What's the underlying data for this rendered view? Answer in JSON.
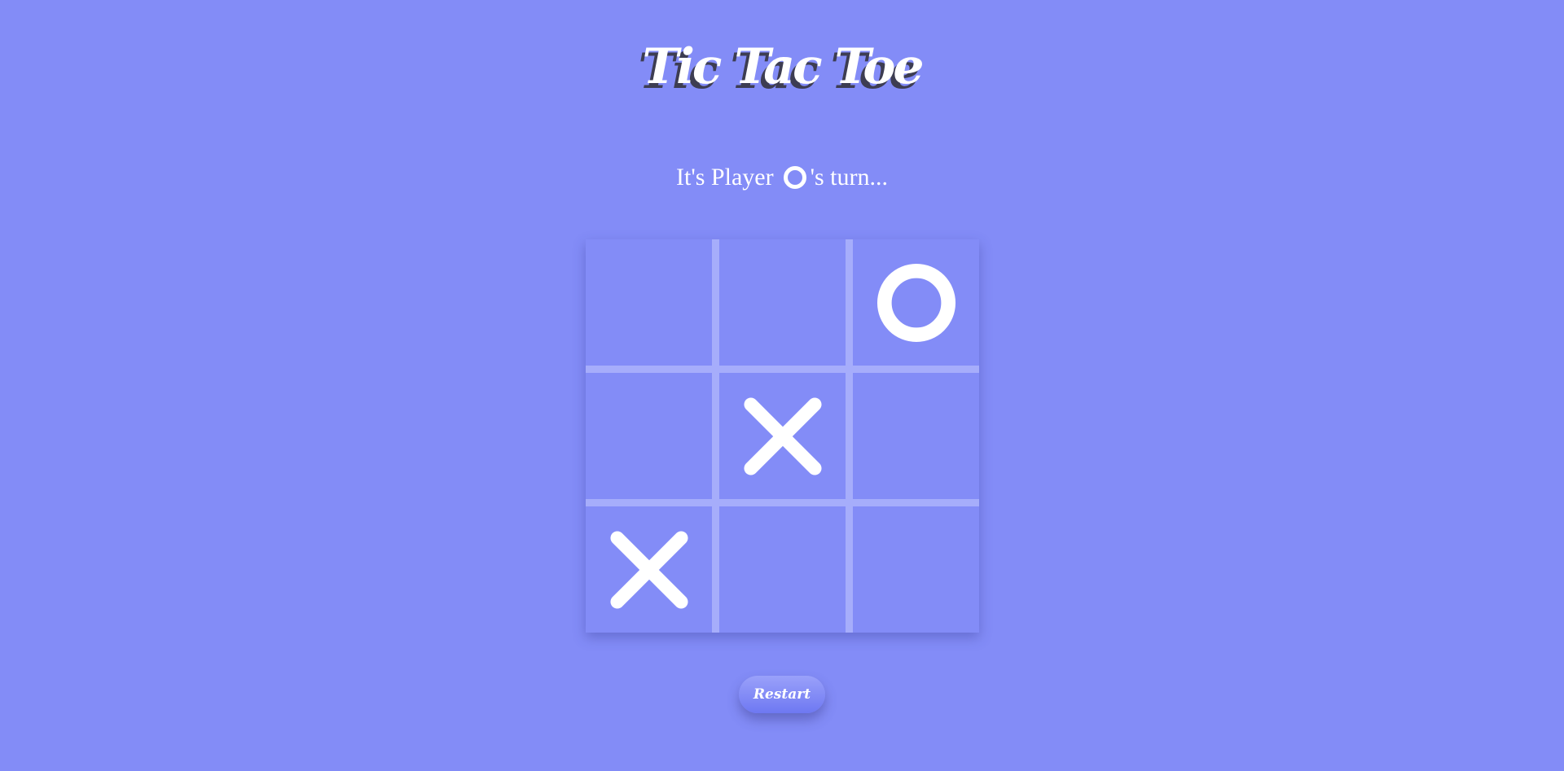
{
  "game": {
    "title": "Tic Tac Toe",
    "status_prefix": "It's Player",
    "current_player": "O",
    "status_suffix": "'s turn..."
  },
  "board": {
    "cells": [
      "",
      "",
      "O",
      "",
      "X",
      "",
      "X",
      "",
      ""
    ]
  },
  "controls": {
    "restart_label": "Restart"
  },
  "colors": {
    "background": "#838cf7",
    "grid_lines": "#a6adfb",
    "marks": "#ffffff",
    "title_shadow": "#3d3d52"
  }
}
